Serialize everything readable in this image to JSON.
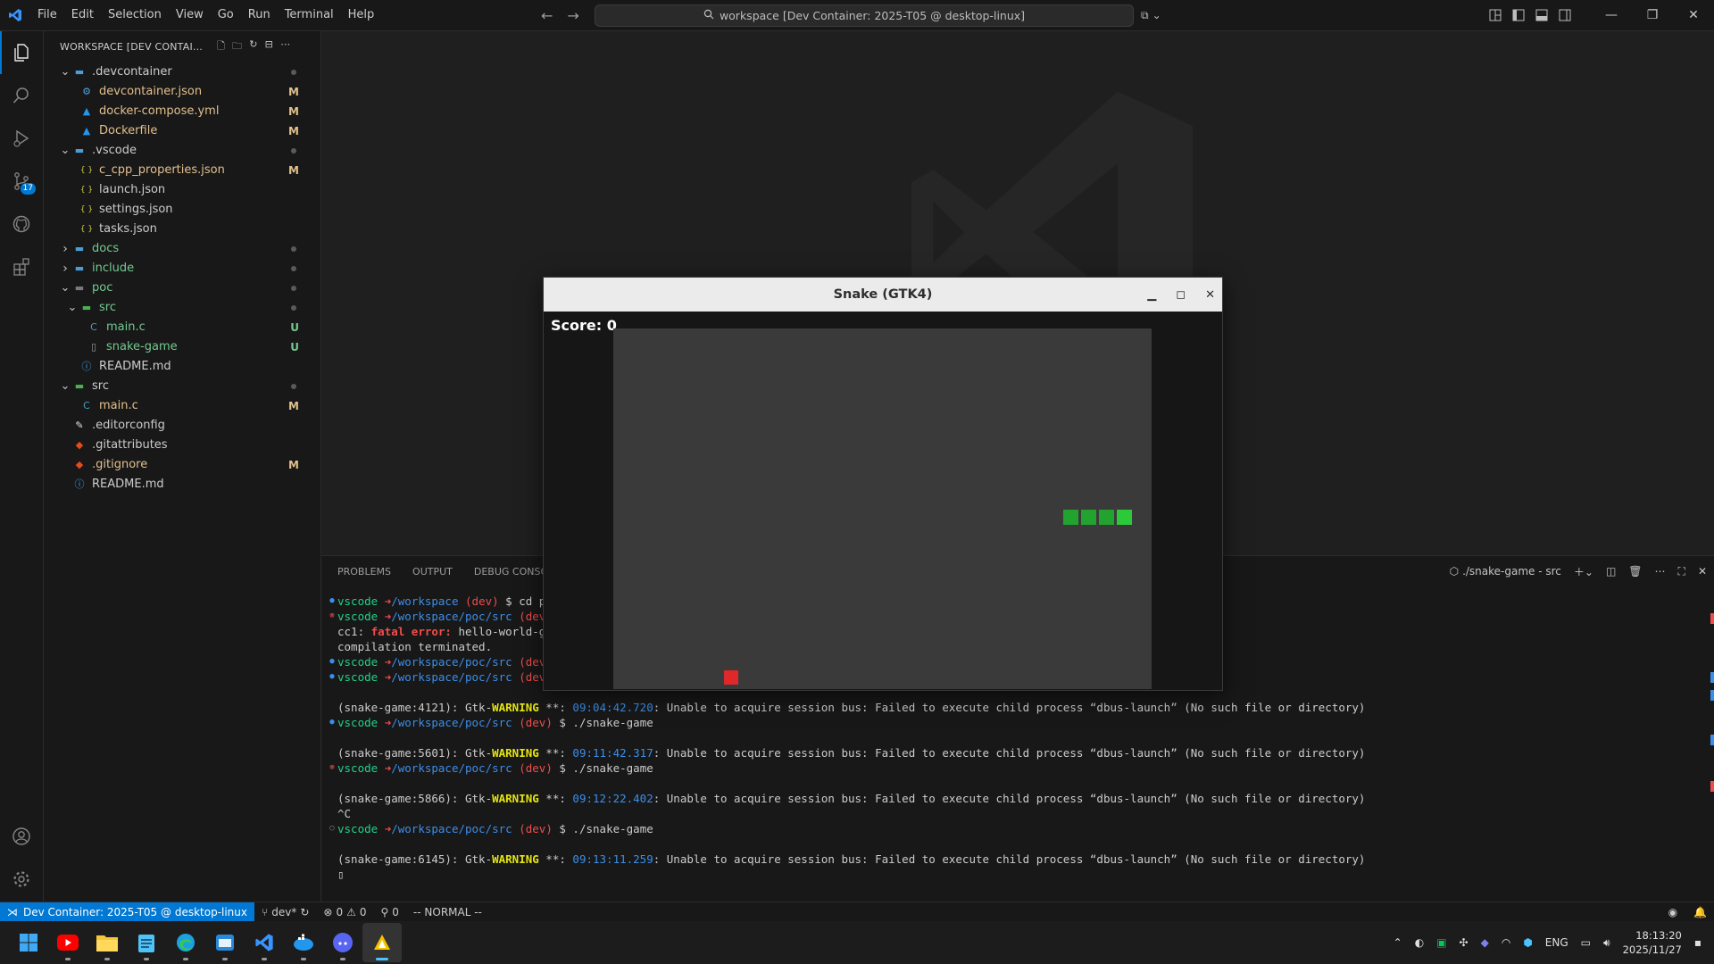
{
  "titlebar": {
    "menu": [
      "File",
      "Edit",
      "Selection",
      "View",
      "Go",
      "Run",
      "Terminal",
      "Help"
    ],
    "command_center": "workspace [Dev Container: 2025-T05 @ desktop-linux]"
  },
  "activity_bar": {
    "source_control_badge": "17"
  },
  "sidebar": {
    "header": "WORKSPACE [DEV CONTAI...",
    "tree": [
      {
        "label": ".devcontainer",
        "depth": 0,
        "type": "folder",
        "open": true,
        "status": "dot",
        "color": "#cccccc",
        "icon": "folder-devcontainer-icon"
      },
      {
        "label": "devcontainer.json",
        "depth": 1,
        "type": "file",
        "status": "M",
        "icon": "json-settings-icon"
      },
      {
        "label": "docker-compose.yml",
        "depth": 1,
        "type": "file",
        "status": "M",
        "icon": "docker-icon"
      },
      {
        "label": "Dockerfile",
        "depth": 1,
        "type": "file",
        "status": "M",
        "icon": "docker-icon"
      },
      {
        "label": ".vscode",
        "depth": 0,
        "type": "folder",
        "open": true,
        "status": "dot",
        "color": "#cccccc",
        "icon": "folder-vscode-icon"
      },
      {
        "label": "c_cpp_properties.json",
        "depth": 1,
        "type": "file",
        "status": "M",
        "icon": "json-icon"
      },
      {
        "label": "launch.json",
        "depth": 1,
        "type": "file",
        "status": "",
        "icon": "json-icon"
      },
      {
        "label": "settings.json",
        "depth": 1,
        "type": "file",
        "status": "",
        "icon": "json-icon"
      },
      {
        "label": "tasks.json",
        "depth": 1,
        "type": "file",
        "status": "",
        "icon": "json-icon"
      },
      {
        "label": "docs",
        "depth": 0,
        "type": "folder",
        "open": false,
        "status": "dot",
        "color": "#73c991",
        "icon": "folder-docs-icon"
      },
      {
        "label": "include",
        "depth": 0,
        "type": "folder",
        "open": false,
        "status": "dot",
        "color": "#73c991",
        "icon": "folder-include-icon"
      },
      {
        "label": "poc",
        "depth": 0,
        "type": "folder",
        "open": true,
        "status": "dot",
        "color": "#73c991",
        "icon": "folder-icon"
      },
      {
        "label": "src",
        "depth": 1,
        "type": "folder",
        "open": true,
        "status": "dot",
        "color": "#73c991",
        "icon": "folder-src-icon"
      },
      {
        "label": "main.c",
        "depth": 2,
        "type": "file",
        "status": "U",
        "color": "#73c991",
        "icon": "c-file-icon"
      },
      {
        "label": "snake-game",
        "depth": 2,
        "type": "file",
        "status": "U",
        "color": "#73c991",
        "icon": "binary-file-icon"
      },
      {
        "label": "README.md",
        "depth": 1,
        "type": "file",
        "status": "",
        "icon": "info-icon"
      },
      {
        "label": "src",
        "depth": 0,
        "type": "folder",
        "open": true,
        "status": "dot",
        "color": "#cccccc",
        "icon": "folder-src-icon"
      },
      {
        "label": "main.c",
        "depth": 1,
        "type": "file",
        "status": "M",
        "icon": "c-file-icon"
      },
      {
        "label": ".editorconfig",
        "depth": 0,
        "type": "file",
        "status": "",
        "icon": "editorconfig-icon"
      },
      {
        "label": ".gitattributes",
        "depth": 0,
        "type": "file",
        "status": "",
        "icon": "git-icon"
      },
      {
        "label": ".gitignore",
        "depth": 0,
        "type": "file",
        "status": "M",
        "icon": "git-icon"
      },
      {
        "label": "README.md",
        "depth": 0,
        "type": "file",
        "status": "",
        "icon": "info-icon"
      }
    ]
  },
  "panel": {
    "tabs": [
      "PROBLEMS",
      "OUTPUT",
      "DEBUG CONSOLE"
    ],
    "terminal_name": "./snake-game - src"
  },
  "terminal": {
    "lines": [
      {
        "deco": "blue",
        "parts": [
          [
            "green",
            "vscode "
          ],
          [
            "arrow",
            "➜"
          ],
          [
            "blue",
            "/workspace "
          ],
          [
            "red",
            "(dev)"
          ],
          [
            "plain",
            " $ cd pc"
          ]
        ]
      },
      {
        "deco": "red",
        "parts": [
          [
            "green",
            "vscode "
          ],
          [
            "arrow",
            "➜"
          ],
          [
            "blue",
            "/workspace/poc/src "
          ],
          [
            "red",
            "(dev)"
          ]
        ]
      },
      {
        "deco": "",
        "parts": [
          [
            "plain",
            "cc1: "
          ],
          [
            "red",
            "fatal error:"
          ],
          [
            "plain",
            " hello-world-gtk"
          ]
        ]
      },
      {
        "deco": "",
        "parts": [
          [
            "plain",
            "compilation terminated."
          ]
        ]
      },
      {
        "deco": "blue",
        "parts": [
          [
            "green",
            "vscode "
          ],
          [
            "arrow",
            "➜"
          ],
          [
            "blue",
            "/workspace/poc/src "
          ],
          [
            "red",
            "(dev)"
          ]
        ]
      },
      {
        "deco": "blue",
        "parts": [
          [
            "green",
            "vscode "
          ],
          [
            "arrow",
            "➜"
          ],
          [
            "blue",
            "/workspace/poc/src "
          ],
          [
            "red",
            "(dev)"
          ]
        ]
      },
      {
        "deco": "",
        "parts": []
      },
      {
        "deco": "",
        "parts": [
          [
            "plain",
            "(snake-game:4121): Gtk-"
          ],
          [
            "yellow",
            "WARNING"
          ],
          [
            "plain",
            " **: "
          ],
          [
            "tsblue",
            "09:04:42.720"
          ],
          [
            "plain",
            ": Unable to acquire session bus: Failed to execute child process “dbus-launch” (No such file or directory)"
          ]
        ]
      },
      {
        "deco": "blue",
        "parts": [
          [
            "green",
            "vscode "
          ],
          [
            "arrow",
            "➜"
          ],
          [
            "blue",
            "/workspace/poc/src "
          ],
          [
            "red",
            "(dev)"
          ],
          [
            "plain",
            " $ ./snake-game"
          ]
        ]
      },
      {
        "deco": "",
        "parts": []
      },
      {
        "deco": "",
        "parts": [
          [
            "plain",
            "(snake-game:5601): Gtk-"
          ],
          [
            "yellow",
            "WARNING"
          ],
          [
            "plain",
            " **: "
          ],
          [
            "tsblue",
            "09:11:42.317"
          ],
          [
            "plain",
            ": Unable to acquire session bus: Failed to execute child process “dbus-launch” (No such file or directory)"
          ]
        ]
      },
      {
        "deco": "red",
        "parts": [
          [
            "green",
            "vscode "
          ],
          [
            "arrow",
            "➜"
          ],
          [
            "blue",
            "/workspace/poc/src "
          ],
          [
            "red",
            "(dev)"
          ],
          [
            "plain",
            " $ ./snake-game"
          ]
        ]
      },
      {
        "deco": "",
        "parts": []
      },
      {
        "deco": "",
        "parts": [
          [
            "plain",
            "(snake-game:5866): Gtk-"
          ],
          [
            "yellow",
            "WARNING"
          ],
          [
            "plain",
            " **: "
          ],
          [
            "tsblue",
            "09:12:22.402"
          ],
          [
            "plain",
            ": Unable to acquire session bus: Failed to execute child process “dbus-launch” (No such file or directory)"
          ]
        ]
      },
      {
        "deco": "",
        "parts": [
          [
            "plain",
            "^C"
          ]
        ]
      },
      {
        "deco": "empty",
        "parts": [
          [
            "green",
            "vscode "
          ],
          [
            "arrow",
            "➜"
          ],
          [
            "blue",
            "/workspace/poc/src "
          ],
          [
            "red",
            "(dev)"
          ],
          [
            "plain",
            " $ ./snake-game"
          ]
        ]
      },
      {
        "deco": "",
        "parts": []
      },
      {
        "deco": "",
        "parts": [
          [
            "plain",
            "(snake-game:6145): Gtk-"
          ],
          [
            "yellow",
            "WARNING"
          ],
          [
            "plain",
            " **: "
          ],
          [
            "tsblue",
            "09:13:11.259"
          ],
          [
            "plain",
            ": Unable to acquire session bus: Failed to execute child process “dbus-launch” (No such file or directory)"
          ]
        ]
      },
      {
        "deco": "",
        "parts": [
          [
            "plain",
            "▯"
          ]
        ]
      }
    ]
  },
  "statusbar": {
    "remote": "Dev Container: 2025-T05 @ desktop-linux",
    "branch": "dev*",
    "errors": "0",
    "warnings": "0",
    "ports": "0",
    "mode": "-- NORMAL --"
  },
  "snake": {
    "title": "Snake (GTK4)",
    "score": "Score: 0",
    "colors": {
      "board": "#3a3a3a",
      "body": "#22a32f",
      "head": "#2cc93a",
      "food": "#e0282a"
    }
  },
  "taskbar": {
    "time": "18:13:20",
    "date": "2025/11/27",
    "lang": "ENG"
  }
}
